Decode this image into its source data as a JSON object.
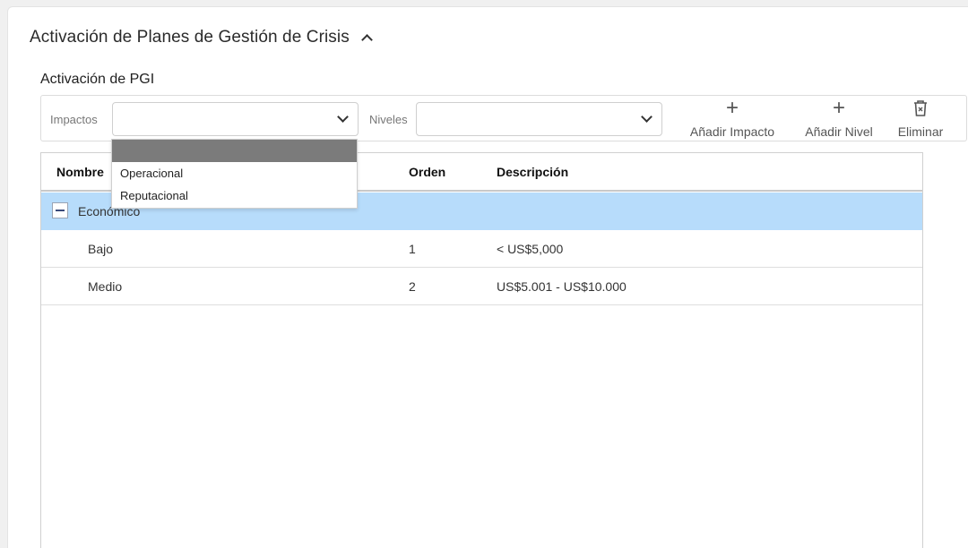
{
  "section": {
    "title": "Activación de Planes de Gestión de Crisis"
  },
  "subsection": {
    "title": "Activación de PGI"
  },
  "toolbar": {
    "impactos_label": "Impactos",
    "impactos_value": "",
    "niveles_label": "Niveles",
    "niveles_value": "",
    "add_impact_label": "Añadir Impacto",
    "add_level_label": "Añadir Nivel",
    "delete_label": "Eliminar",
    "plus_glyph": "+",
    "trash_glyph": "🗑"
  },
  "dropdown": {
    "options": [
      "",
      "Operacional",
      "Reputacional"
    ]
  },
  "table": {
    "columns": [
      "Nombre",
      "Orden",
      "Descripción"
    ],
    "group": {
      "name": "Económico"
    },
    "rows": [
      {
        "name": "Bajo",
        "order": "1",
        "description": "< US$5,000"
      },
      {
        "name": "Medio",
        "order": "2",
        "description": "US$5.001 - US$10.000"
      }
    ]
  },
  "colors": {
    "selected_row": "#b7dcfb",
    "dropdown_highlight": "#7b7b7b"
  }
}
